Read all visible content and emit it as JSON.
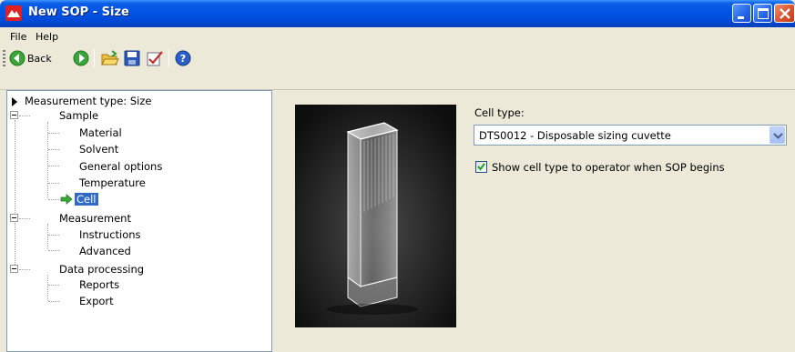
{
  "window": {
    "title": "New SOP - Size"
  },
  "menu": {
    "file": "File",
    "help": "Help"
  },
  "toolbar": {
    "back_label": "Back"
  },
  "tree": {
    "root": "Measurement type: Size",
    "groups": [
      {
        "label": "Sample",
        "children": [
          "Material",
          "Solvent",
          "General options",
          "Temperature",
          "Cell"
        ]
      },
      {
        "label": "Measurement",
        "children": [
          "Instructions",
          "Advanced"
        ]
      },
      {
        "label": "Data processing",
        "children": [
          "Reports",
          "Export"
        ]
      }
    ],
    "selected": "Cell"
  },
  "cell_settings": {
    "cell_type_label": "Cell type:",
    "cell_type_value": "DTS0012 - Disposable sizing cuvette",
    "show_to_operator_label": "Show cell type to operator when SOP begins",
    "show_to_operator_checked": true
  }
}
